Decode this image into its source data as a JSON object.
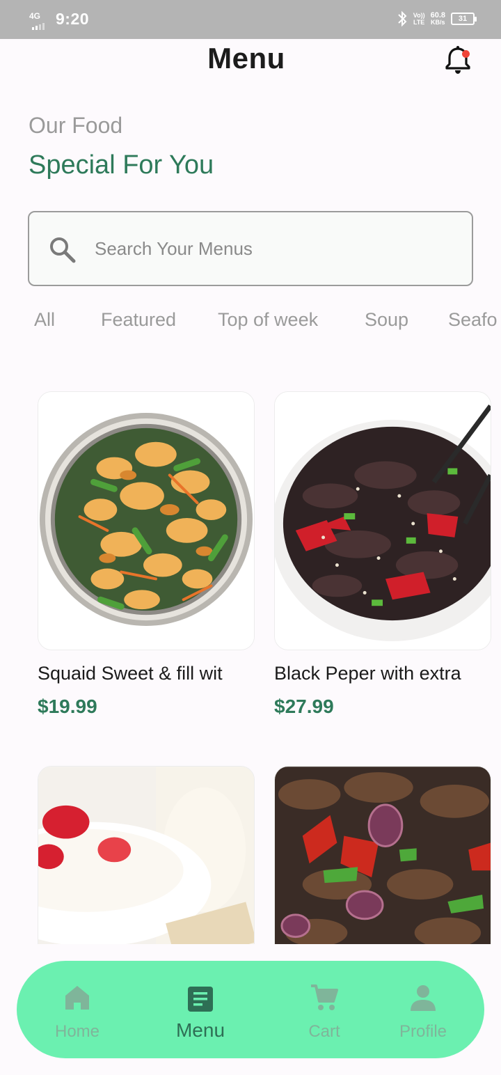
{
  "status_bar": {
    "network": "4G",
    "time": "9:20",
    "volte_top": "Vo))",
    "volte_bottom": "LTE",
    "speed_value": "60.8",
    "speed_unit": "KB/s",
    "battery": "31"
  },
  "header": {
    "title": "Menu",
    "notification_badge_color": "#f04438"
  },
  "intro": {
    "subtitle": "Our Food",
    "heading": "Special For You"
  },
  "search": {
    "placeholder": "Search Your Menus",
    "value": ""
  },
  "categories": [
    {
      "label": "All"
    },
    {
      "label": "Featured"
    },
    {
      "label": "Top of week"
    },
    {
      "label": "Soup"
    },
    {
      "label": "Seafo"
    }
  ],
  "menu_items": [
    {
      "name": "Squaid Sweet & fill wit",
      "price": "$19.99",
      "image": "fried-squid-dish"
    },
    {
      "name": "Black Peper with extra",
      "price": "$27.99",
      "image": "black-pepper-beef-bowl"
    },
    {
      "name": "",
      "price": "",
      "image": "yogurt-strawberry-dessert"
    },
    {
      "name": "",
      "price": "",
      "image": "beef-pepper-stir-fry"
    }
  ],
  "bottom_nav": [
    {
      "label": "Home",
      "icon": "home-icon",
      "active": false
    },
    {
      "label": "Menu",
      "icon": "menu-doc-icon",
      "active": true
    },
    {
      "label": "Cart",
      "icon": "cart-icon",
      "active": false
    },
    {
      "label": "Profile",
      "icon": "profile-icon",
      "active": false
    }
  ],
  "colors": {
    "accent": "#2e7a5a",
    "nav_background": "#6bf0b0",
    "muted_text": "#9a9a9a"
  }
}
